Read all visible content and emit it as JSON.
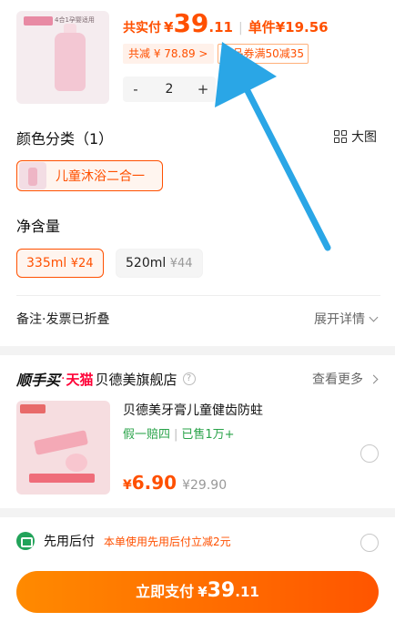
{
  "product": {
    "thumb_tagline": "4合1孕婴适用",
    "total_label": "共实付",
    "total_yen": "¥",
    "total_int": "39",
    "total_dec": ".11",
    "separator": "|",
    "unit_price": "单件¥19.56",
    "reduction_chip": "共减 ¥ 78.89 >",
    "coupon_chip": "商品券满50减35",
    "quantity": "2",
    "minus_label": "-",
    "plus_label": "+"
  },
  "color_section": {
    "title": "颜色分类（1）",
    "big_image_label": "大图",
    "selected_variant": "儿童沐浴二合一"
  },
  "size_section": {
    "title": "净含量",
    "options": [
      {
        "label": "335ml",
        "price": "¥24",
        "selected": true
      },
      {
        "label": "520ml",
        "price": "¥44",
        "selected": false
      }
    ]
  },
  "remark": {
    "label": "备注·发票已折叠",
    "expand_label": "展开详情"
  },
  "store": {
    "brand_prefix": "顺手买",
    "dot": "·",
    "tmall": "天猫",
    "name": "贝德美旗舰店",
    "help": "?",
    "more_label": "查看更多"
  },
  "recommend_item": {
    "title": "贝德美牙膏儿童健齿防蛀",
    "badge_guarantee": "假一赔四",
    "badge_bar": "|",
    "badge_sold": "已售1万+",
    "price_yen": "¥",
    "price_value": "6.90",
    "original_price": "¥29.90"
  },
  "pay_later": {
    "label": "先用后付",
    "note": "本单使用先用后付立减2元"
  },
  "pay_button": {
    "label": "立即支付",
    "yen": "¥",
    "int": "39",
    "dec": ".11"
  },
  "colors": {
    "accent": "#ff5000",
    "green": "#2aa34a",
    "annotation_arrow": "#2aa6e6"
  }
}
